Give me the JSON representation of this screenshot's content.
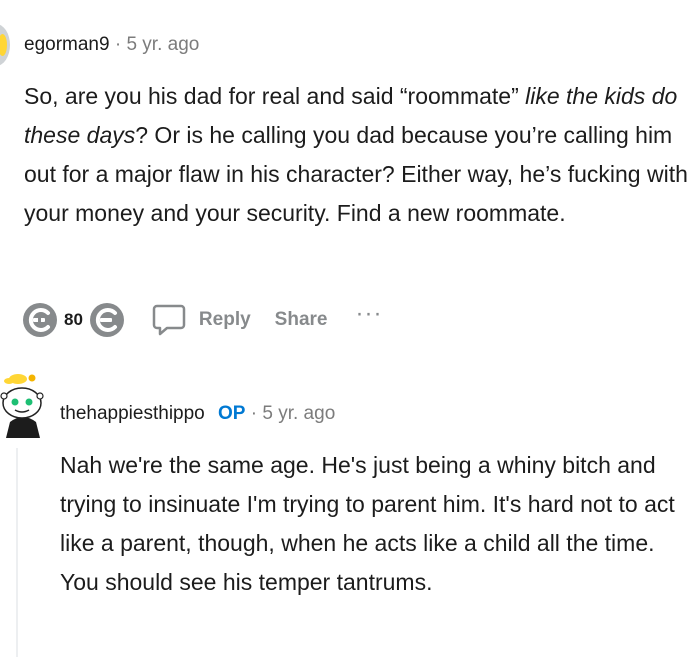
{
  "comment1": {
    "username": "egorman9",
    "separator": "·",
    "timestamp": "5 yr. ago",
    "body_part1": "So, are you his dad for real and said “roommate” ",
    "body_italic1": "like the kids do these days",
    "body_part2": "? Or is he calling you dad because you’re calling him out for a major flaw in his character? Either way, he’s fucking with your money and your security. Find a new roommate.",
    "vote_count": "80",
    "reply_label": "Reply",
    "share_label": "Share",
    "more_label": "···"
  },
  "comment2": {
    "username": "thehappiesthippo",
    "op_badge": "OP",
    "separator": "·",
    "timestamp": "5 yr. ago",
    "body": "Nah we're the same age. He's just being a whiny bitch and trying to insinuate I'm trying to parent him. It's hard not to act like a parent, though, when he acts like a child all the time. You should see his temper tantrums."
  },
  "colors": {
    "op_blue": "#0079d3",
    "meta_gray": "#7c7c7c",
    "action_gray": "#878a8c"
  }
}
